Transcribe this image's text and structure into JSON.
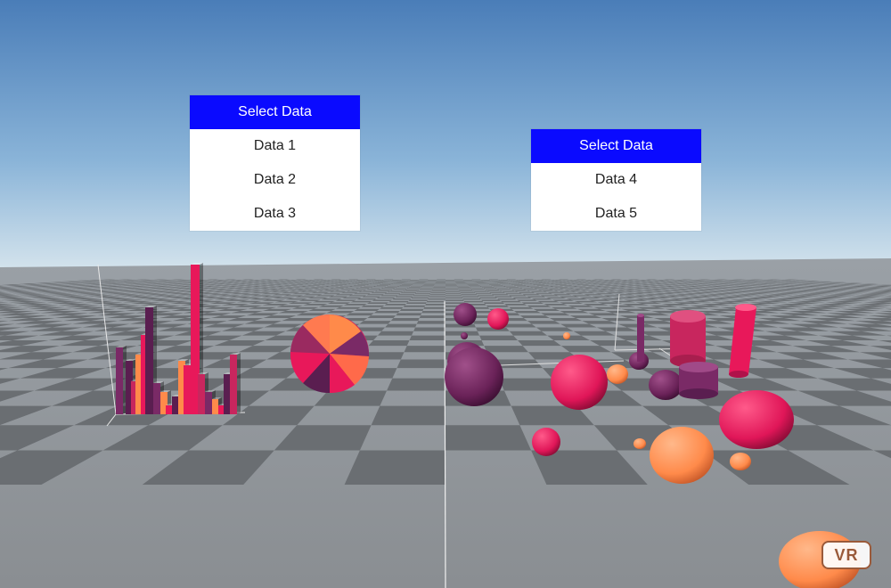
{
  "colors": {
    "menu_header": "#0a0aff",
    "plum": "#7a2a66",
    "pink": "#e8185a",
    "magenta": "#c8265e",
    "orange": "#ff8a4a",
    "dark_purple": "#5a1e50"
  },
  "left_menu": {
    "header": "Select Data",
    "items": [
      {
        "label": "Data 1"
      },
      {
        "label": "Data 2"
      },
      {
        "label": "Data 3"
      }
    ]
  },
  "right_menu": {
    "header": "Select Data",
    "items": [
      {
        "label": "Data 4"
      },
      {
        "label": "Data 5"
      }
    ]
  },
  "vr_button": {
    "label": "VR"
  }
}
